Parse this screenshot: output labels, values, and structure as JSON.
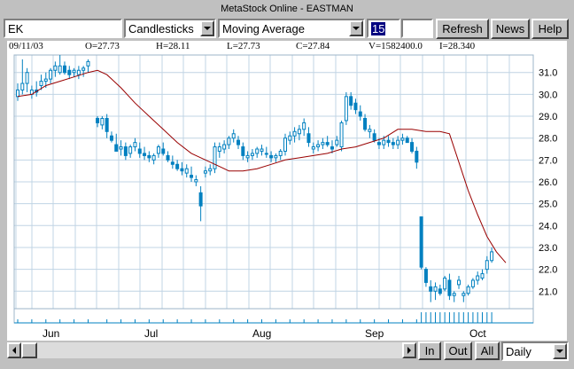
{
  "window_title": "MetaStock Online - EASTMAN",
  "toolbar": {
    "symbol_value": "EK",
    "chart_type_value": "Candlesticks",
    "indicator_value": "Moving Average",
    "period_value": "15",
    "blank_value": "",
    "refresh_label": "Refresh",
    "news_label": "News",
    "help_label": "Help"
  },
  "info": {
    "date": "09/11/03",
    "open": "O=27.73",
    "high": "H=28.11",
    "low": "L=27.73",
    "close": "C=27.84",
    "volume": "V=1582400.0",
    "indicator": "I=28.340"
  },
  "bottom": {
    "in_label": "In",
    "out_label": "Out",
    "all_label": "All",
    "interval_value": "Daily"
  },
  "colors": {
    "candle": "#0080c0",
    "moving_average": "#990000",
    "grid": "#c0d4e4",
    "panel_bg": "#ffffff",
    "selected_bg": "#000080"
  },
  "chart_data": {
    "type": "line",
    "y_ticks": [
      "31.0",
      "30.0",
      "29.0",
      "28.0",
      "27.0",
      "26.0",
      "25.0",
      "24.0",
      "23.0",
      "22.0",
      "21.0"
    ],
    "x_ticks": [
      "Jun",
      "Jul",
      "Aug",
      "Sep",
      "Oct"
    ],
    "ylim": [
      20.2,
      31.8
    ],
    "moving_average_points": [
      [
        0,
        29.9
      ],
      [
        3,
        30.0
      ],
      [
        6,
        30.4
      ],
      [
        9,
        30.6
      ],
      [
        12,
        30.8
      ],
      [
        15,
        31.0
      ],
      [
        17,
        31.1
      ],
      [
        19,
        30.9
      ],
      [
        22,
        30.3
      ],
      [
        25,
        29.6
      ],
      [
        28,
        29.0
      ],
      [
        31,
        28.4
      ],
      [
        34,
        27.8
      ],
      [
        37,
        27.3
      ],
      [
        40,
        27.0
      ],
      [
        43,
        26.7
      ],
      [
        45,
        26.5
      ],
      [
        48,
        26.5
      ],
      [
        51,
        26.6
      ],
      [
        54,
        26.8
      ],
      [
        57,
        27.0
      ],
      [
        60,
        27.1
      ],
      [
        63,
        27.2
      ],
      [
        66,
        27.3
      ],
      [
        69,
        27.5
      ],
      [
        72,
        27.6
      ],
      [
        75,
        27.8
      ],
      [
        78,
        28.0
      ],
      [
        81,
        28.4
      ],
      [
        84,
        28.4
      ],
      [
        87,
        28.3
      ],
      [
        90,
        28.3
      ],
      [
        92,
        28.2
      ],
      [
        94,
        26.9
      ],
      [
        96,
        25.6
      ],
      [
        98,
        24.5
      ],
      [
        100,
        23.5
      ],
      [
        102,
        22.8
      ],
      [
        104,
        22.3
      ]
    ],
    "candles": [
      [
        0,
        29.9,
        30.5,
        29.7,
        30.2
      ],
      [
        1,
        30.2,
        31.6,
        30.0,
        30.5
      ],
      [
        2,
        30.5,
        31.2,
        30.1,
        31.0
      ],
      [
        3,
        30.0,
        30.4,
        29.8,
        30.2
      ],
      [
        4,
        30.2,
        30.6,
        29.9,
        30.1
      ],
      [
        5,
        30.4,
        30.9,
        30.2,
        30.6
      ],
      [
        6,
        30.6,
        31.0,
        30.3,
        30.7
      ],
      [
        7,
        30.7,
        31.2,
        30.5,
        31.1
      ],
      [
        8,
        31.1,
        31.5,
        30.8,
        31.3
      ],
      [
        9,
        31.0,
        31.8,
        30.9,
        31.3
      ],
      [
        10,
        31.3,
        31.5,
        30.9,
        31.0
      ],
      [
        11,
        31.1,
        31.3,
        30.7,
        30.9
      ],
      [
        12,
        31.0,
        31.2,
        30.8,
        31.1
      ],
      [
        13,
        30.9,
        31.3,
        30.7,
        31.1
      ],
      [
        14,
        31.1,
        31.3,
        30.8,
        31.2
      ],
      [
        15,
        31.3,
        31.6,
        31.0,
        31.5
      ],
      [
        17,
        28.9,
        29.0,
        28.5,
        28.7
      ],
      [
        18,
        28.6,
        29.0,
        28.4,
        28.9
      ],
      [
        19,
        28.9,
        29.1,
        28.0,
        28.3
      ],
      [
        20,
        28.1,
        28.3,
        27.8,
        27.9
      ],
      [
        21,
        27.7,
        28.2,
        27.5,
        27.4
      ],
      [
        22,
        27.5,
        27.9,
        27.2,
        27.6
      ],
      [
        23,
        27.6,
        27.8,
        27.0,
        27.2
      ],
      [
        24,
        27.3,
        27.7,
        27.1,
        27.6
      ],
      [
        25,
        27.6,
        28.0,
        27.4,
        27.8
      ],
      [
        26,
        27.5,
        27.8,
        27.1,
        27.3
      ],
      [
        27,
        27.3,
        27.6,
        27.0,
        27.2
      ],
      [
        28,
        27.2,
        27.4,
        26.9,
        27.1
      ],
      [
        29,
        27.0,
        27.3,
        26.8,
        27.2
      ],
      [
        30,
        27.3,
        27.7,
        27.1,
        27.6
      ],
      [
        31,
        27.5,
        27.8,
        27.2,
        27.3
      ],
      [
        32,
        27.2,
        27.4,
        26.9,
        27.0
      ],
      [
        33,
        26.9,
        27.2,
        26.6,
        26.8
      ],
      [
        34,
        26.8,
        27.0,
        26.5,
        26.6
      ],
      [
        35,
        26.6,
        26.9,
        26.3,
        26.5
      ],
      [
        36,
        26.4,
        26.8,
        26.2,
        26.6
      ],
      [
        37,
        26.3,
        26.7,
        26.0,
        26.2
      ],
      [
        38,
        26.0,
        26.3,
        25.8,
        26.1
      ],
      [
        39,
        25.5,
        25.8,
        24.2,
        24.9
      ],
      [
        40,
        26.4,
        26.7,
        26.2,
        26.5
      ],
      [
        41,
        26.5,
        26.8,
        26.3,
        26.6
      ],
      [
        42,
        26.6,
        27.8,
        26.4,
        27.6
      ],
      [
        43,
        27.4,
        27.8,
        27.1,
        27.6
      ],
      [
        44,
        27.5,
        27.9,
        27.3,
        27.7
      ],
      [
        45,
        27.7,
        28.1,
        27.5,
        28.0
      ],
      [
        46,
        28.0,
        28.4,
        27.8,
        28.2
      ],
      [
        47,
        27.9,
        28.1,
        27.5,
        27.7
      ],
      [
        48,
        27.6,
        27.8,
        27.0,
        27.2
      ],
      [
        49,
        27.1,
        27.4,
        26.9,
        27.2
      ],
      [
        50,
        27.2,
        27.5,
        27.0,
        27.3
      ],
      [
        51,
        27.3,
        27.6,
        27.1,
        27.5
      ],
      [
        52,
        27.4,
        27.7,
        27.2,
        27.5
      ],
      [
        53,
        27.3,
        27.6,
        27.1,
        27.3
      ],
      [
        54,
        27.2,
        27.4,
        26.9,
        27.1
      ],
      [
        55,
        27.1,
        27.3,
        26.9,
        27.2
      ],
      [
        56,
        27.2,
        27.5,
        27.0,
        27.4
      ],
      [
        57,
        27.4,
        28.2,
        27.2,
        28.0
      ],
      [
        58,
        27.9,
        28.3,
        27.7,
        28.1
      ],
      [
        59,
        28.1,
        28.5,
        27.8,
        28.3
      ],
      [
        60,
        28.2,
        28.6,
        27.9,
        28.4
      ],
      [
        61,
        28.4,
        28.9,
        28.1,
        28.7
      ],
      [
        62,
        28.2,
        28.5,
        27.6,
        27.8
      ],
      [
        63,
        27.5,
        27.8,
        27.3,
        27.6
      ],
      [
        64,
        27.6,
        27.9,
        27.4,
        27.7
      ],
      [
        65,
        27.7,
        28.0,
        27.5,
        27.8
      ],
      [
        66,
        27.8,
        28.1,
        27.6,
        27.7
      ],
      [
        67,
        27.6,
        27.9,
        27.3,
        27.5
      ],
      [
        68,
        27.7,
        28.1,
        27.6,
        27.9
      ],
      [
        69,
        27.6,
        28.8,
        27.4,
        28.7
      ],
      [
        70,
        28.8,
        30.1,
        28.6,
        29.9
      ],
      [
        71,
        29.9,
        30.1,
        29.3,
        29.5
      ],
      [
        72,
        29.6,
        29.8,
        29.1,
        29.3
      ],
      [
        73,
        29.2,
        29.5,
        28.8,
        29.0
      ],
      [
        74,
        28.9,
        29.1,
        28.3,
        28.4
      ],
      [
        75,
        28.3,
        28.6,
        28.0,
        28.4
      ],
      [
        76,
        28.2,
        28.4,
        27.8,
        27.9
      ],
      [
        77,
        27.8,
        28.0,
        27.5,
        27.7
      ],
      [
        78,
        27.7,
        28.1,
        27.5,
        27.9
      ],
      [
        79,
        27.9,
        28.1,
        27.6,
        27.8
      ],
      [
        80,
        27.8,
        28.0,
        27.5,
        27.7
      ],
      [
        81,
        27.7,
        28.1,
        27.5,
        27.9
      ],
      [
        82,
        27.9,
        28.2,
        27.7,
        28.0
      ],
      [
        83,
        28.0,
        28.1,
        27.8,
        27.8
      ],
      [
        84,
        27.8,
        28.0,
        27.3,
        27.4
      ],
      [
        85,
        27.4,
        27.6,
        26.6,
        26.9
      ],
      [
        86,
        24.4,
        24.4,
        22.0,
        22.1
      ],
      [
        87,
        22.0,
        22.1,
        21.2,
        21.4
      ],
      [
        88,
        21.2,
        21.5,
        20.5,
        21.0
      ],
      [
        89,
        21.0,
        21.4,
        20.6,
        21.2
      ],
      [
        90,
        21.1,
        21.3,
        20.8,
        20.9
      ],
      [
        91,
        21.1,
        21.7,
        21.0,
        21.6
      ],
      [
        92,
        21.5,
        21.8,
        20.6,
        20.8
      ],
      [
        93,
        20.8,
        21.0,
        20.5,
        20.9
      ],
      [
        94,
        21.3,
        21.7,
        21.1,
        21.5
      ],
      [
        95,
        20.8,
        21.0,
        20.5,
        20.9
      ],
      [
        96,
        20.9,
        21.3,
        20.8,
        21.2
      ],
      [
        97,
        21.2,
        21.6,
        21.1,
        21.5
      ],
      [
        98,
        21.5,
        21.9,
        21.3,
        21.7
      ],
      [
        99,
        21.6,
        22.0,
        21.5,
        21.8
      ],
      [
        100,
        22.0,
        22.6,
        21.8,
        22.4
      ],
      [
        101,
        22.4,
        23.0,
        22.3,
        22.8
      ]
    ]
  }
}
